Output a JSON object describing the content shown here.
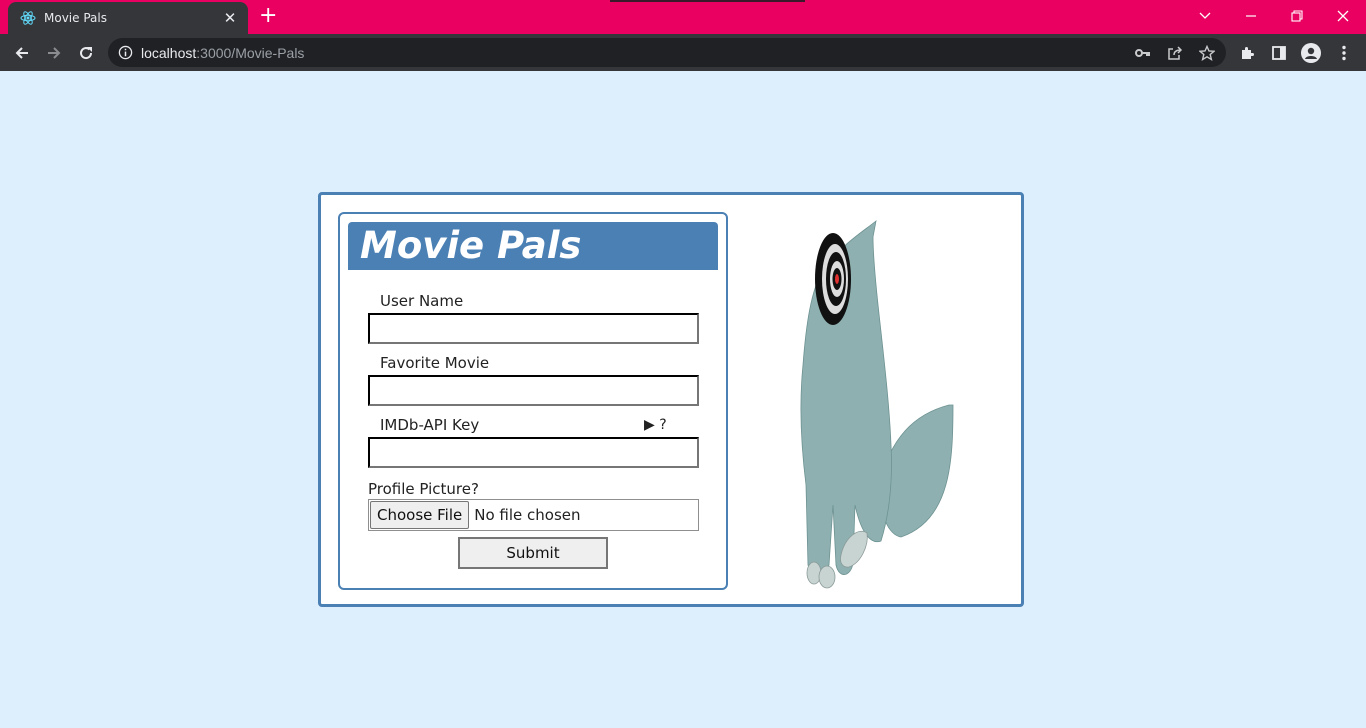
{
  "browser": {
    "tab_title": "Movie Pals",
    "url_host": "localhost",
    "url_rest": ":3000/Movie-Pals"
  },
  "app": {
    "title": "Movie Pals",
    "fields": {
      "user_name_label": "User Name",
      "user_name_value": "",
      "favorite_movie_label": "Favorite Movie",
      "favorite_movie_value": "",
      "api_key_label": "IMDb-API Key",
      "api_key_value": "",
      "api_key_help": "▶ ?"
    },
    "profile_picture_label": "Profile Picture?",
    "file_button_label": "Choose File",
    "file_status": "No file chosen",
    "submit_label": "Submit"
  },
  "colors": {
    "tabstrip": "#ea0060",
    "page_background": "#ddeefd",
    "accent_blue": "#4a80b4",
    "cat_body": "#8eb0b0"
  },
  "icons": [
    "react-favicon",
    "close-icon",
    "plus-icon",
    "chevron-down-icon",
    "minimize-icon",
    "restore-icon",
    "window-close-icon",
    "back-icon",
    "forward-icon",
    "reload-icon",
    "info-icon",
    "key-icon",
    "share-icon",
    "star-icon",
    "extensions-icon",
    "side-panel-icon",
    "profile-icon",
    "menu-icon"
  ]
}
